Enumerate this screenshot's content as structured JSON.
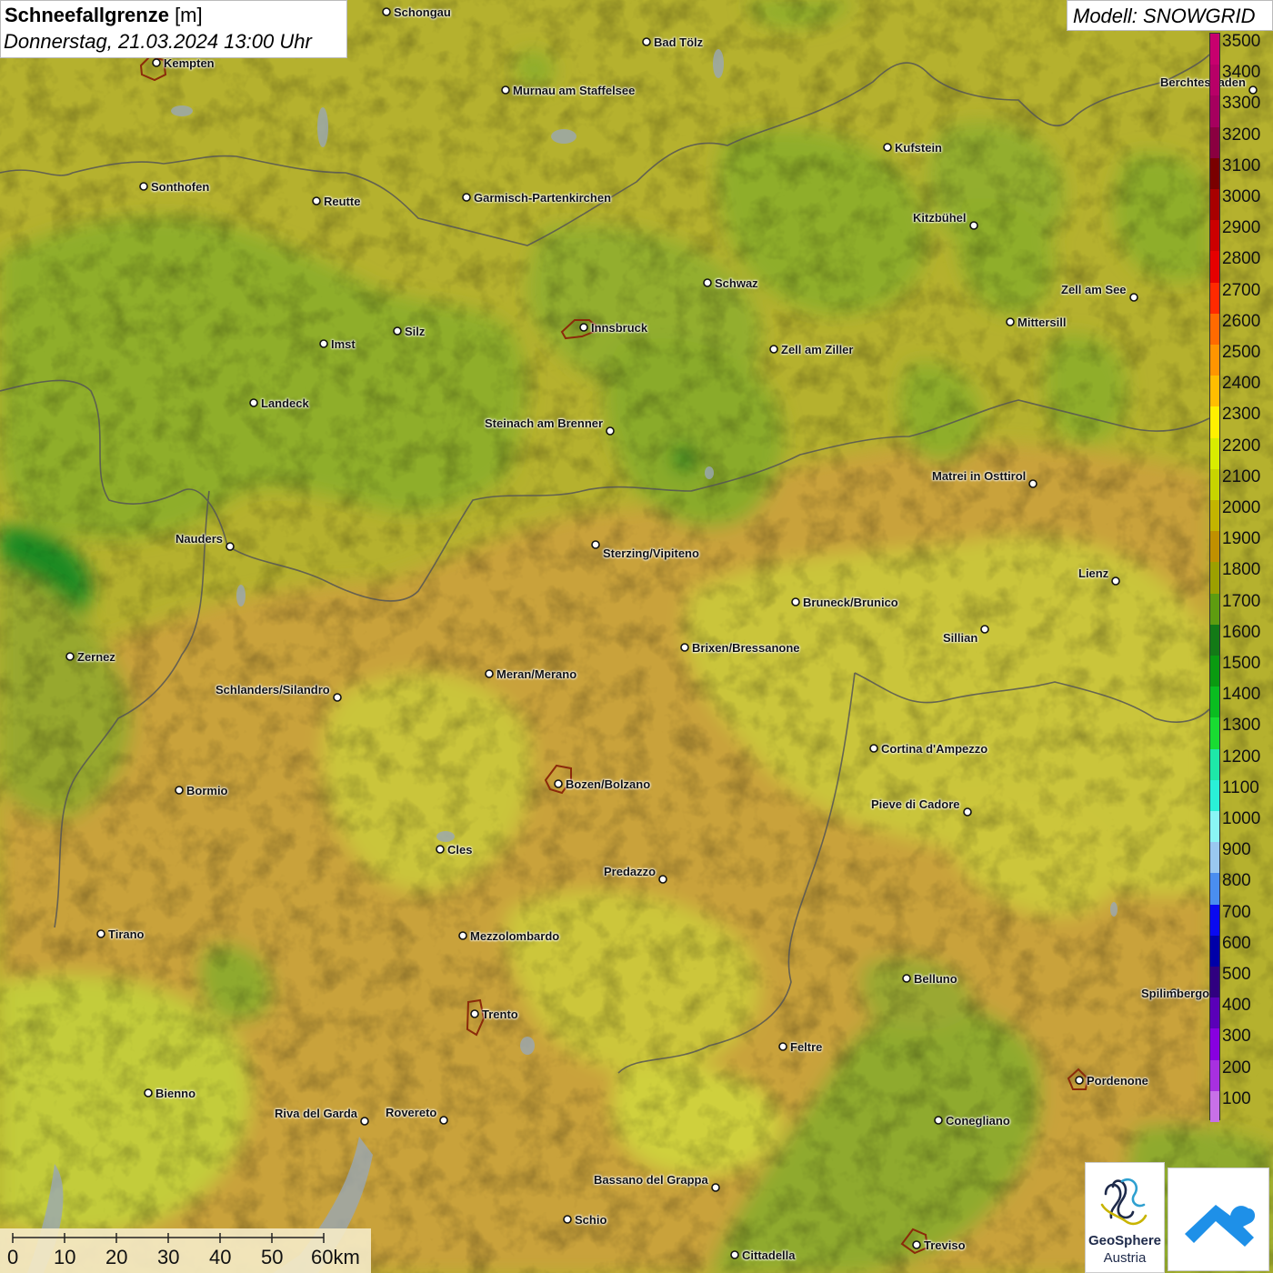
{
  "header": {
    "title_bold": "Schneefallgrenze",
    "title_unit": " [m]",
    "datetime": "Donnerstag, 21.03.2024 13:00 Uhr"
  },
  "model": {
    "label": "Modell: SNOWGRID"
  },
  "legend": {
    "levels": [
      {
        "label": "3500",
        "color": "#c8006e"
      },
      {
        "label": "3400",
        "color": "#b80067"
      },
      {
        "label": "3300",
        "color": "#a6005e"
      },
      {
        "label": "3200",
        "color": "#8a0040"
      },
      {
        "label": "3100",
        "color": "#7a0000"
      },
      {
        "label": "3000",
        "color": "#a80000"
      },
      {
        "label": "2900",
        "color": "#cc0000"
      },
      {
        "label": "2800",
        "color": "#e60000"
      },
      {
        "label": "2700",
        "color": "#ff2a00"
      },
      {
        "label": "2600",
        "color": "#ff6a00"
      },
      {
        "label": "2500",
        "color": "#ff9500"
      },
      {
        "label": "2400",
        "color": "#ffbe00"
      },
      {
        "label": "2300",
        "color": "#fff000"
      },
      {
        "label": "2200",
        "color": "#d8ec00"
      },
      {
        "label": "2100",
        "color": "#c7d400"
      },
      {
        "label": "2000",
        "color": "#c2b400"
      },
      {
        "label": "1900",
        "color": "#c09000"
      },
      {
        "label": "1800",
        "color": "#9ca000"
      },
      {
        "label": "1700",
        "color": "#5e9c10"
      },
      {
        "label": "1600",
        "color": "#137a16"
      },
      {
        "label": "1500",
        "color": "#0a9a10"
      },
      {
        "label": "1400",
        "color": "#0abd20"
      },
      {
        "label": "1300",
        "color": "#19dc32"
      },
      {
        "label": "1200",
        "color": "#1ee8a8"
      },
      {
        "label": "1100",
        "color": "#2af0d8"
      },
      {
        "label": "1000",
        "color": "#8af5f5"
      },
      {
        "label": "900",
        "color": "#9ac8f0"
      },
      {
        "label": "800",
        "color": "#4a8ef0"
      },
      {
        "label": "700",
        "color": "#0a0af0"
      },
      {
        "label": "600",
        "color": "#0000a8"
      },
      {
        "label": "500",
        "color": "#300080"
      },
      {
        "label": "400",
        "color": "#5a00b8"
      },
      {
        "label": "300",
        "color": "#8800e0"
      },
      {
        "label": "200",
        "color": "#a830e0"
      },
      {
        "label": "100",
        "color": "#c870e8"
      }
    ]
  },
  "cities": [
    {
      "name": "Schongau"
    },
    {
      "name": "Bad Tölz"
    },
    {
      "name": "Kempten"
    },
    {
      "name": "Murnau am Staffelsee"
    },
    {
      "name": "Berchtesgaden"
    },
    {
      "name": "Kufstein"
    },
    {
      "name": "Sonthofen"
    },
    {
      "name": "Reutte"
    },
    {
      "name": "Garmisch-Partenkirchen"
    },
    {
      "name": "Kitzbühel"
    },
    {
      "name": "Schwaz"
    },
    {
      "name": "Zell am See"
    },
    {
      "name": "Innsbruck"
    },
    {
      "name": "Mittersill"
    },
    {
      "name": "Imst"
    },
    {
      "name": "Silz"
    },
    {
      "name": "Zell am Ziller"
    },
    {
      "name": "Landeck"
    },
    {
      "name": "Steinach am Brenner"
    },
    {
      "name": "Matrei in Osttirol"
    },
    {
      "name": "Nauders"
    },
    {
      "name": "Sterzing/Vipiteno"
    },
    {
      "name": "Lienz"
    },
    {
      "name": "Bruneck/Brunico"
    },
    {
      "name": "Sillian"
    },
    {
      "name": "Zernez"
    },
    {
      "name": "Brixen/Bressanone"
    },
    {
      "name": "Meran/Merano"
    },
    {
      "name": "Schlanders/Silandro"
    },
    {
      "name": "Cortina d'Ampezzo"
    },
    {
      "name": "Bozen/Bolzano"
    },
    {
      "name": "Bormio"
    },
    {
      "name": "Pieve di Cadore"
    },
    {
      "name": "Cles"
    },
    {
      "name": "Predazzo"
    },
    {
      "name": "Tirano"
    },
    {
      "name": "Mezzolombardo"
    },
    {
      "name": "Belluno"
    },
    {
      "name": "Spilimbergo"
    },
    {
      "name": "Trento"
    },
    {
      "name": "Feltre"
    },
    {
      "name": "Pordenone"
    },
    {
      "name": "Bienno"
    },
    {
      "name": "Riva del Garda"
    },
    {
      "name": "Rovereto"
    },
    {
      "name": "Conegliano"
    },
    {
      "name": "Bassano del Grappa"
    },
    {
      "name": "Schio"
    },
    {
      "name": "Treviso"
    },
    {
      "name": "Cittadella"
    }
  ],
  "scale_bar": {
    "ticks": [
      "0",
      "10",
      "20",
      "30",
      "40",
      "50",
      "60km"
    ]
  },
  "logos": {
    "geosphere_line1": "GeoSphere",
    "geosphere_line2": "Austria"
  },
  "colors": {
    "green_zone": "#8fae2c",
    "olive_zone": "#b5b12e",
    "orange_zone": "#c8a338",
    "yellow_zone": "#cac838",
    "border": "#555555"
  }
}
